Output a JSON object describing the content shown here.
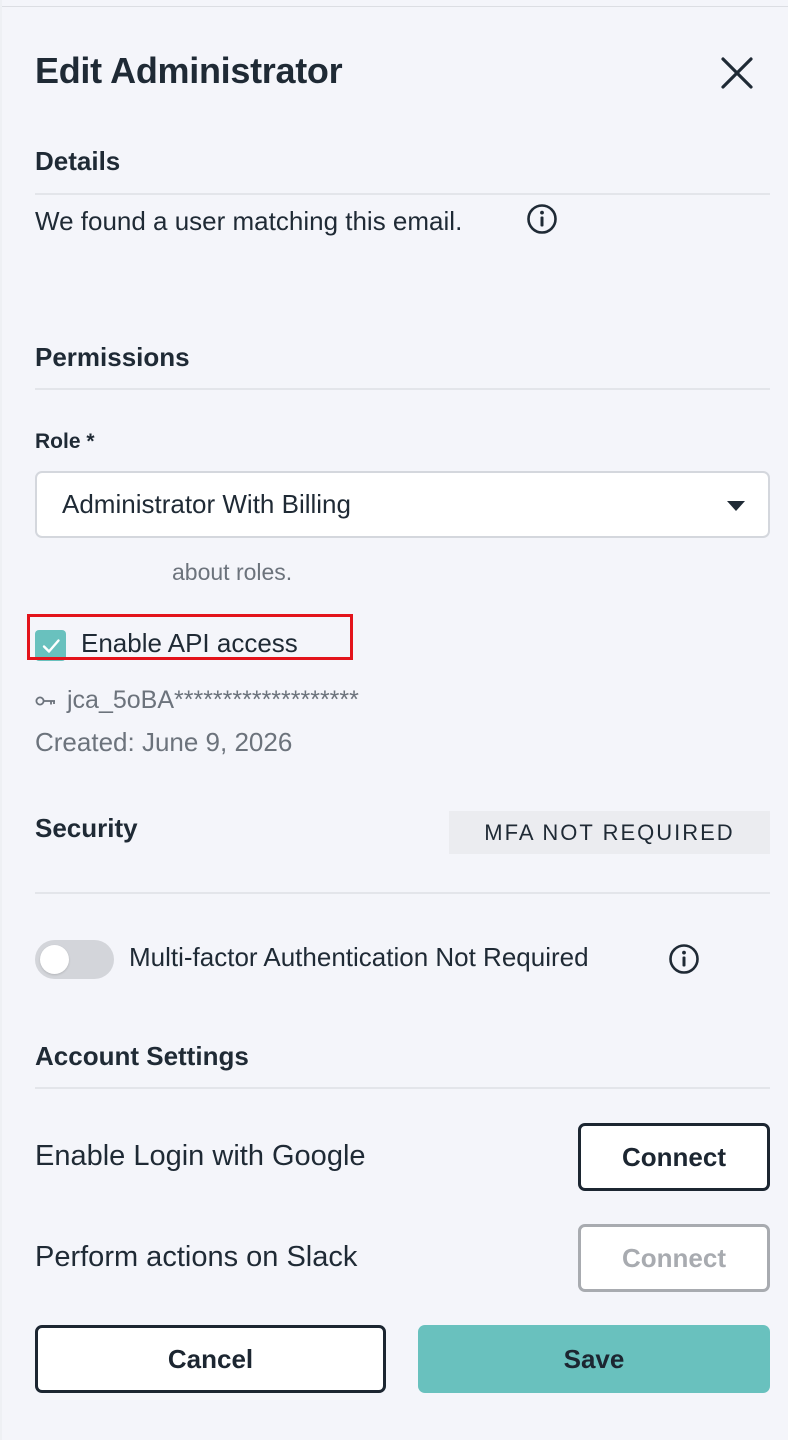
{
  "header": {
    "title": "Edit Administrator",
    "close_icon": "close-icon"
  },
  "details": {
    "section_title": "Details",
    "message": "We found a user matching this email.",
    "info_icon": "info-icon"
  },
  "permissions": {
    "section_title": "Permissions",
    "role_label": "Role *",
    "role_value": "Administrator With Billing",
    "help_text": "about roles.",
    "api_access_label": "Enable API access",
    "api_access_checked": true,
    "api_key_icon": "key-icon",
    "api_key_masked": "jca_5oBA*******************",
    "created_text": "Created: June 9, 2026"
  },
  "security": {
    "section_title": "Security",
    "badge": "MFA NOT REQUIRED",
    "mfa_toggle_on": false,
    "mfa_label": "Multi-factor Authentication Not Required",
    "info_icon": "info-icon"
  },
  "account_settings": {
    "section_title": "Account Settings",
    "google_label": "Enable Login with Google",
    "google_button": "Connect",
    "slack_label": "Perform actions on Slack",
    "slack_button": "Connect"
  },
  "footer": {
    "cancel_label": "Cancel",
    "save_label": "Save"
  },
  "colors": {
    "accent": "#69c1be",
    "text": "#1c2631",
    "muted": "#6c737c",
    "highlight": "#e3131b",
    "background": "#f4f5fa"
  }
}
